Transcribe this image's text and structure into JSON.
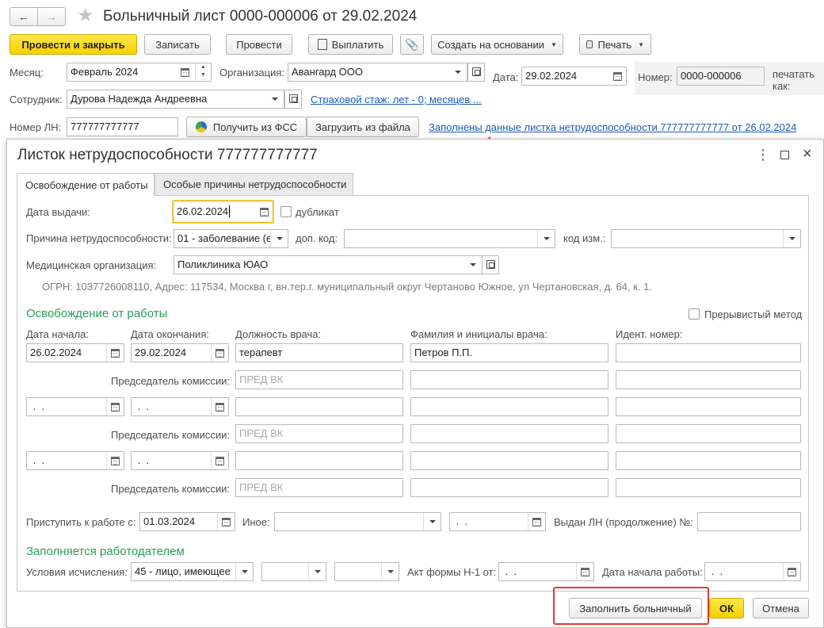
{
  "window": {
    "title": "Больничный лист 0000-000006 от 29.02.2024"
  },
  "toolbar": {
    "post_close": "Провести и закрыть",
    "save": "Записать",
    "post": "Провести",
    "pay": "Выплатить",
    "create_based": "Создать на основании",
    "print": "Печать"
  },
  "header": {
    "month_label": "Месяц:",
    "month_value": "Февраль 2024",
    "org_label": "Организация:",
    "org_value": "Авангард ООО",
    "date_label": "Дата:",
    "date_value": "29.02.2024",
    "number_label": "Номер:",
    "number_value": "0000-000006",
    "print_as_label": "печатать как:",
    "employee_label": "Сотрудник:",
    "employee_value": "Дурова Надежда Андреевна",
    "insurance_link": "Страховой стаж: лет - 0; месяцев ...",
    "ln_label": "Номер ЛН:",
    "ln_value": "777777777777",
    "get_fss": "Получить из ФСС",
    "load_file": "Загрузить из файла",
    "filled_link": "Заполнены данные листка нетрудоспособности 777777777777 от 26.02.2024"
  },
  "dialog": {
    "title": "Листок нетрудоспособности 777777777777",
    "tabs": [
      "Освобождение от работы",
      "Особые причины нетрудоспособности"
    ],
    "issue_date_label": "Дата выдачи:",
    "issue_date_value": "26.02.2024",
    "duplicate_label": "дубликат",
    "reason_label": "Причина нетрудоспособности:",
    "reason_value": "01 - заболевание (е",
    "add_code_label": "доп. код:",
    "change_code_label": "код изм.:",
    "med_org_label": "Медицинская организация:",
    "med_org_value": "Поликлиника ЮАО",
    "ogrn_text": "ОГРН: 1037726008110, Адрес: 117534, Москва г, вн.тер.г. муниципальный округ Чертаново Южное, ул Чертановская, д. 64, к. 1.",
    "release_section": "Освобождение от работы",
    "intermittent_label": "Прерывистый метод",
    "col_start": "Дата начала:",
    "col_end": "Дата окончания:",
    "col_position": "Должность врача:",
    "col_doctor": "Фамилия и инициалы врача:",
    "col_ident": "Идент.  номер:",
    "row1_start": "26.02.2024",
    "row1_end": "29.02.2024",
    "row1_position": "терапевт",
    "row1_doctor": "Петров П.П.",
    "chairman_label": "Председатель комиссии:",
    "chairman_placeholder": "ПРЕД ВК",
    "empty_date": " .  .",
    "return_label": "Приступить к работе с:",
    "return_value": "01.03.2024",
    "other_label": "Иное:",
    "issued_cont_label": "Выдан ЛН (продолжение) №:",
    "employer_section": "Заполняется работодателем",
    "calc_cond_label": "Условия исчисления:",
    "calc_cond_value": "45 - лицо, имеющее",
    "act_label": "Акт формы Н-1 от:",
    "work_start_label": "Дата начала работы:",
    "fill_button": "Заполнить больничный",
    "ok_button": "ОК",
    "cancel_button": "Отмена"
  }
}
